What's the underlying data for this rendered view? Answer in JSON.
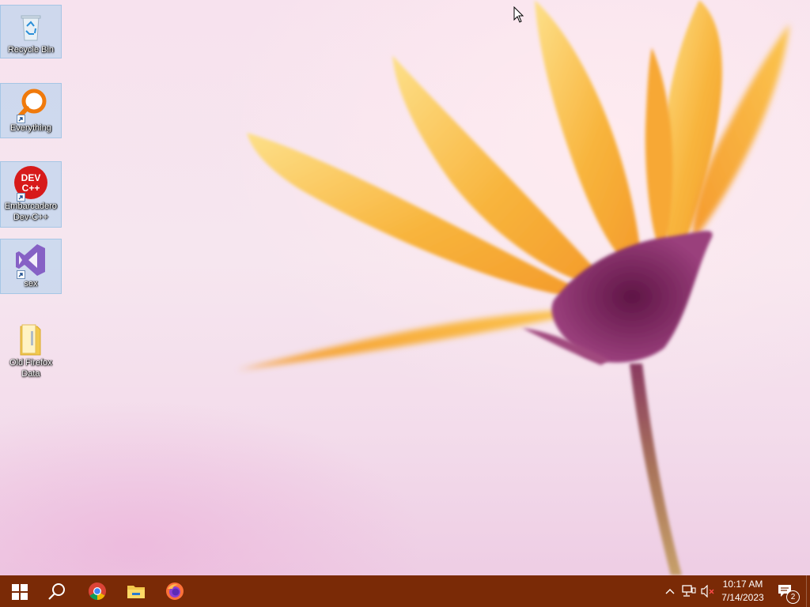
{
  "desktop": {
    "icons": [
      {
        "label": "Recycle Bin",
        "icon": "recycle-bin-icon",
        "shortcut": false
      },
      {
        "label": "Everything",
        "icon": "everything-search-icon",
        "shortcut": true
      },
      {
        "label": "Embarcadero Dev-C++",
        "icon": "devcpp-icon",
        "icon_text_line1": "DEV",
        "icon_text_line2": "C++",
        "shortcut": true
      },
      {
        "label": "sex",
        "icon": "visual-studio-icon",
        "shortcut": true
      },
      {
        "label": "Old Firefox Data",
        "icon": "folder-icon",
        "shortcut": false
      }
    ]
  },
  "taskbar": {
    "background": "#7a2a06",
    "buttons": [
      {
        "name": "start",
        "icon": "windows-logo-icon"
      },
      {
        "name": "search",
        "icon": "search-icon"
      },
      {
        "name": "chrome",
        "icon": "chrome-icon"
      },
      {
        "name": "file-explorer",
        "icon": "file-explorer-icon"
      },
      {
        "name": "firefox",
        "icon": "firefox-icon"
      }
    ],
    "tray": {
      "icons": [
        "chevron-up-icon",
        "network-icon",
        "volume-muted-icon"
      ],
      "time": "10:17 AM",
      "date": "7/14/2023",
      "notification_count": "2"
    }
  },
  "colors": {
    "flower_petals": "#f7b23a",
    "flower_center": "#7a2458",
    "wallpaper": "#f6e4ee"
  }
}
